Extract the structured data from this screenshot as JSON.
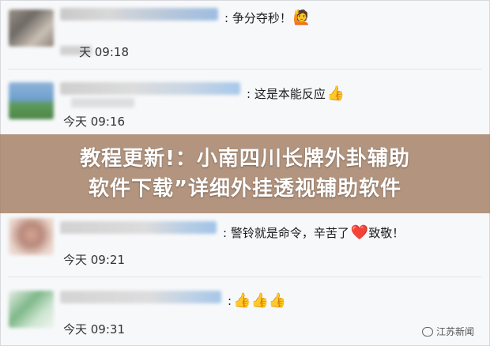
{
  "comments": [
    {
      "message": ": 争分夺秒！",
      "emoji": "🙋",
      "time": "天 09:18"
    },
    {
      "message": ": 这是本能反应",
      "emoji": "👍",
      "time": "今天 09:16"
    },
    {
      "message": ": 警铃就是命令，辛苦了",
      "emoji": "❤️",
      "message_after": "致敬！",
      "time": "今天 09:21"
    },
    {
      "message": ":",
      "emoji": "👍👍👍",
      "time": "今天 09:31"
    }
  ],
  "overlay": {
    "line1": "教程更新!：小南四川长牌外卦辅助",
    "line2": "软件下载”详细外挂透视辅助软件"
  },
  "watermark": {
    "text": "江苏新闻",
    "icon": "wechat-channel-icon"
  }
}
